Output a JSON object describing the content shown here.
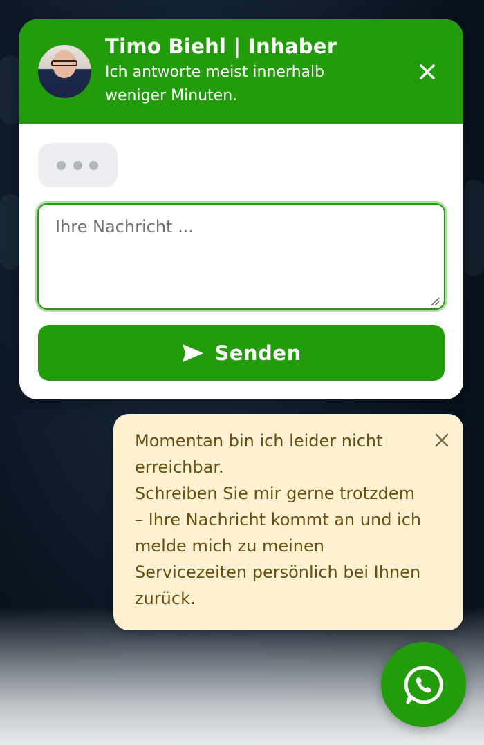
{
  "colors": {
    "brand_green": "#239c0c",
    "notice_bg": "#fdf1d2",
    "notice_text": "#6b4f10"
  },
  "chat": {
    "header": {
      "title": "Timo Biehl | Inhaber",
      "subtitle": "Ich antworte meist innerhalb weniger Minuten.",
      "avatar_icon": "person-photo",
      "close_icon": "close-icon"
    },
    "typing_indicator_icon": "typing-dots-icon",
    "message_placeholder": "Ihre Nachricht ...",
    "message_value": "",
    "send_label": "Senden",
    "send_icon": "send-icon"
  },
  "notice": {
    "line1": "Momentan bin ich leider nicht erreichbar.",
    "line2": "Schreiben Sie mir gerne trotzdem – Ihre Nachricht kommt an und ich melde mich zu meinen Servicezeiten persönlich bei Ihnen zurück.",
    "close_icon": "close-icon"
  },
  "fab": {
    "icon": "whatsapp-icon"
  }
}
